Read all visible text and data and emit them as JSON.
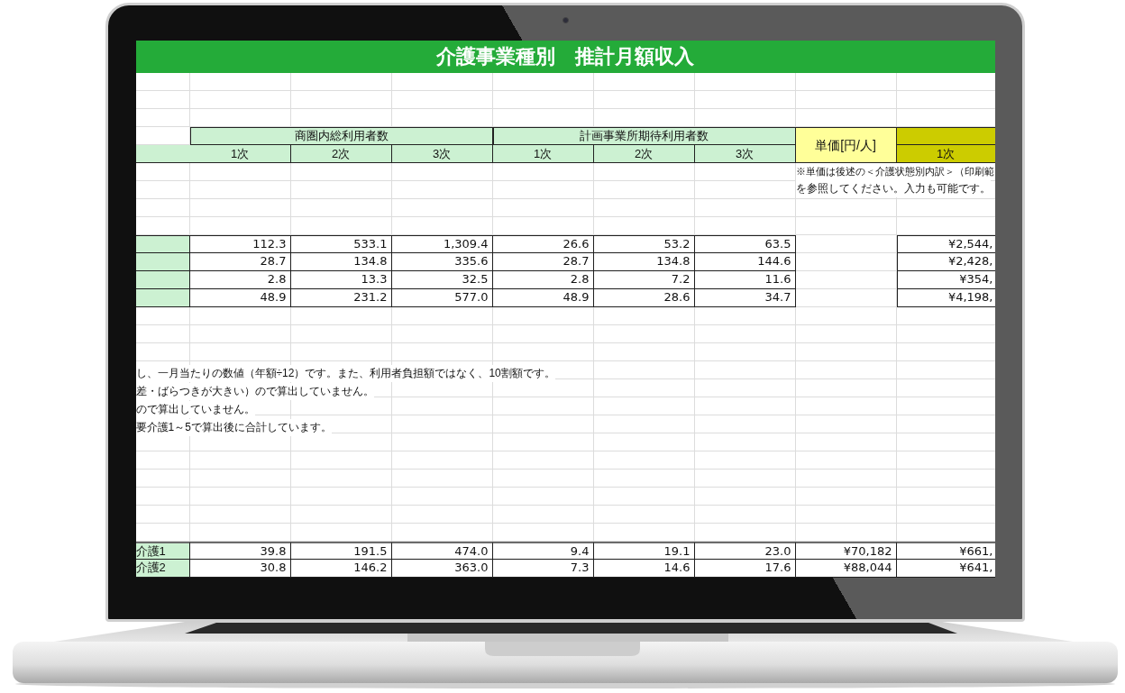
{
  "title": "介護事業種別　推計月額収入",
  "column_groups": [
    {
      "label": "商圏内総利用者数",
      "periods": [
        "1次",
        "2次",
        "3次"
      ]
    },
    {
      "label": "計画事業所期待利用者数",
      "periods": [
        "1次",
        "2次",
        "3次"
      ]
    }
  ],
  "unit_price_header": "単価[円/人]",
  "column_9_header": "1次",
  "price_note": [
    "※単価は後述の＜介護状態別内訳＞（印刷範",
    "を参照してください。入力も可能です。"
  ],
  "summary_rows": [
    {
      "values": [
        "112.3",
        "533.1",
        "1,309.4",
        "26.6",
        "53.2",
        "63.5"
      ],
      "column_9": "¥2,544,"
    },
    {
      "values": [
        "28.7",
        "134.8",
        "335.6",
        "28.7",
        "134.8",
        "144.6"
      ],
      "column_9": "¥2,428,"
    },
    {
      "values": [
        "2.8",
        "13.3",
        "32.5",
        "2.8",
        "7.2",
        "11.6"
      ],
      "column_9": "¥354,"
    },
    {
      "values": [
        "48.9",
        "231.2",
        "577.0",
        "48.9",
        "28.6",
        "34.7"
      ],
      "column_9": "¥4,198,"
    }
  ],
  "footnotes": [
    "し、一月当たりの数値（年額÷12）です。また、利用者負担額ではなく、10割額です。",
    "差・ばらつきが大きい）ので算出していません。",
    "ので算出していません。",
    "要介護1～5で算出後に合計しています。"
  ],
  "care_rows": [
    {
      "label": "介護1",
      "values": [
        "39.8",
        "191.5",
        "474.0",
        "9.4",
        "19.1",
        "23.0"
      ],
      "unit_price": "¥70,182",
      "column_9": "¥661,"
    },
    {
      "label": "介護2",
      "values": [
        "30.8",
        "146.2",
        "363.0",
        "7.3",
        "14.6",
        "17.6"
      ],
      "unit_price": "¥88,044",
      "column_9": "¥641,"
    }
  ]
}
